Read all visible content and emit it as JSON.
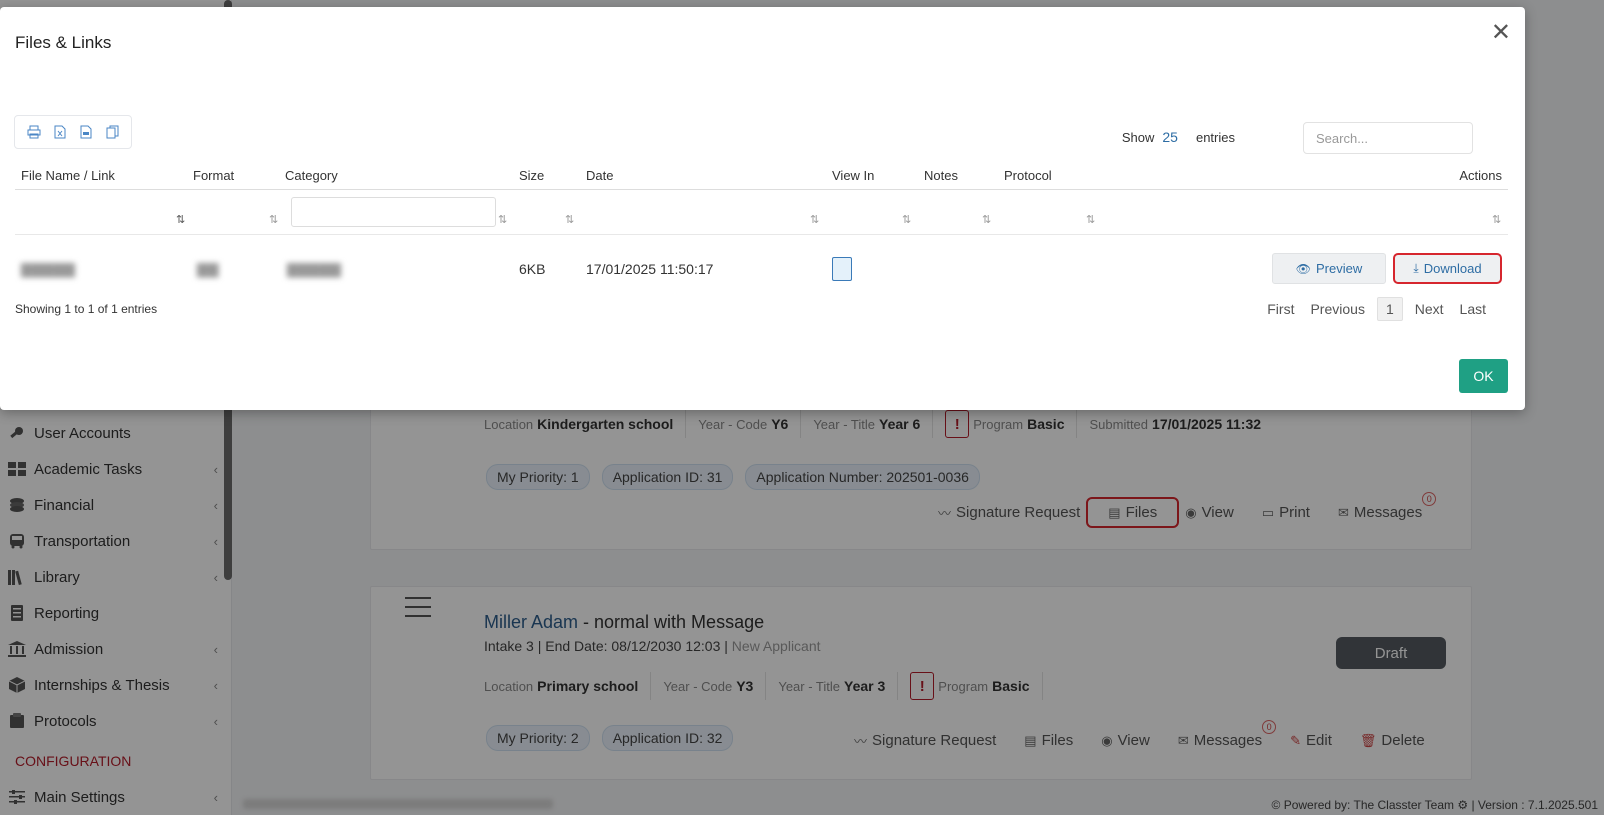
{
  "sidebar": {
    "items": [
      {
        "label": "User Accounts",
        "icon": "key-icon",
        "chevron": false
      },
      {
        "label": "Academic Tasks",
        "icon": "grid-icon",
        "chevron": true
      },
      {
        "label": "Financial",
        "icon": "coins-icon",
        "chevron": true
      },
      {
        "label": "Transportation",
        "icon": "bus-icon",
        "chevron": true
      },
      {
        "label": "Library",
        "icon": "books-icon",
        "chevron": true
      },
      {
        "label": "Reporting",
        "icon": "report-icon",
        "chevron": false
      },
      {
        "label": "Admission",
        "icon": "building-icon",
        "chevron": true
      },
      {
        "label": "Internships & Thesis",
        "icon": "cube-icon",
        "chevron": true
      },
      {
        "label": "Protocols",
        "icon": "folder-icon",
        "chevron": true
      }
    ],
    "section_label": "CONFIGURATION",
    "settings_item": "Main Settings"
  },
  "card1": {
    "location_label": "Location",
    "location": "Kindergarten school",
    "year_code_label": "Year - Code",
    "year_code": "Y6",
    "year_title_label": "Year - Title",
    "year_title": "Year 6",
    "program_label": "Program",
    "program": "Basic",
    "submitted_label": "Submitted",
    "submitted": "17/01/2025 11:32",
    "pills": [
      "My Priority: 1",
      "Application ID: 31",
      "Application Number: 202501-0036"
    ],
    "actions": {
      "signature": "Signature Request",
      "files": "Files",
      "view": "View",
      "print": "Print",
      "messages": "Messages",
      "messages_count": "0"
    }
  },
  "card2": {
    "name": "Miller Adam",
    "name_suffix": " - normal with Message",
    "intake": "Intake 3 | End Date: 08/12/2030 12:03 | ",
    "status_text": "New Applicant",
    "draft": "Draft",
    "location_label": "Location",
    "location": "Primary school",
    "year_code_label": "Year - Code",
    "year_code": "Y3",
    "year_title_label": "Year - Title",
    "year_title": "Year 3",
    "program_label": "Program",
    "program": "Basic",
    "pills": [
      "My Priority: 2",
      "Application ID: 32"
    ],
    "actions": {
      "signature": "Signature Request",
      "files": "Files",
      "view": "View",
      "messages": "Messages",
      "messages_count": "0",
      "edit": "Edit",
      "delete": "Delete"
    }
  },
  "footer": {
    "powered": "Powered by: The Classter Team",
    "version": "| Version : 7.1.2025.501"
  },
  "modal": {
    "title": "Files & Links",
    "show_label": "Show",
    "show_value": "25",
    "entries_label": "entries",
    "search_placeholder": "Search...",
    "columns": [
      "File Name / Link",
      "Format",
      "Category",
      "Size",
      "Date",
      "View In",
      "Notes",
      "Protocol",
      "Actions"
    ],
    "row": {
      "size": "6KB",
      "date": "17/01/2025 11:50:17",
      "preview": "Preview",
      "download": "Download"
    },
    "showing": "Showing 1 to 1 of 1 entries",
    "pager": {
      "first": "First",
      "previous": "Previous",
      "current": "1",
      "next": "Next",
      "last": "Last"
    },
    "ok": "OK"
  },
  "colors": {
    "accent": "#2e6da4",
    "ok": "#1fa084",
    "highlight": "#d6262e",
    "config": "#b31d2a"
  }
}
